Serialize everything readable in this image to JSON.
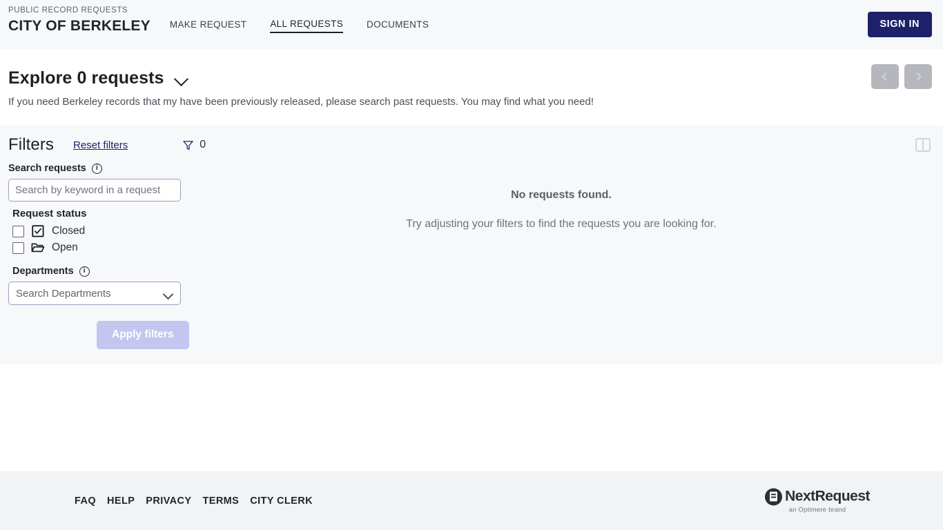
{
  "header": {
    "eyebrow": "PUBLIC RECORD REQUESTS",
    "title": "CITY OF BERKELEY",
    "nav": [
      {
        "label": "MAKE REQUEST",
        "active": false
      },
      {
        "label": "ALL REQUESTS",
        "active": true
      },
      {
        "label": "DOCUMENTS",
        "active": false
      }
    ],
    "sign_in_label": "SIGN IN",
    "sign_in_color": "#1c2169"
  },
  "hero": {
    "title": "Explore 0 requests",
    "description": "If you need Berkeley records that my have been previously released, please search past requests. You may find what you need!",
    "expand_icon": "chevron-down-icon",
    "pager": {
      "prev_icon": "chevron-left-icon",
      "next_icon": "chevron-right-icon",
      "disabled": true
    }
  },
  "filters": {
    "heading": "Filters",
    "reset_label": "Reset filters",
    "active_count": "0",
    "funnel_icon": "filter-funnel-icon",
    "panel_toggle_icon": "panel-layout-icon",
    "search": {
      "label": "Search requests",
      "info_icon": "info-icon",
      "value": "",
      "placeholder": "Search by keyword in a request"
    },
    "status": {
      "label": "Request status",
      "options": [
        {
          "label": "Closed",
          "checked": false,
          "icon": "checked-box-icon"
        },
        {
          "label": "Open",
          "checked": false,
          "icon": "open-folder-icon"
        }
      ]
    },
    "departments": {
      "label": "Departments",
      "info_icon": "info-icon",
      "selected": "Search Departments",
      "chevron_icon": "chevron-down-icon"
    },
    "apply_label": "Apply filters",
    "apply_disabled": true,
    "apply_color": "#c3c6ef"
  },
  "results": {
    "empty_title": "No requests found.",
    "empty_subtitle": "Try adjusting your filters to find the requests you are looking for."
  },
  "footer": {
    "links": [
      "FAQ",
      "HELP",
      "PRIVACY",
      "TERMS",
      "CITY CLERK"
    ],
    "logo_name": "NextRequest",
    "logo_tagline": "an Optimere brand",
    "logo_icon": "nextrequest-document-icon"
  }
}
